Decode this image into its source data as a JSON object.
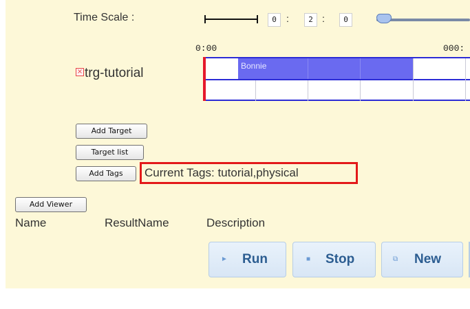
{
  "time_scale": {
    "label": "Time Scale :",
    "fields": [
      "0",
      "2",
      "0"
    ],
    "separator": ":"
  },
  "timeline": {
    "start_time": "0:00",
    "end_time": "000:",
    "bar_label": "Bonnie"
  },
  "target": {
    "icon": "close-icon",
    "name": "trg-tutorial"
  },
  "buttons": {
    "add_target": "Add Target",
    "target_list": "Target list",
    "add_tags": "Add Tags",
    "add_viewer": "Add Viewer"
  },
  "current_tags": "Current Tags: tutorial,physical",
  "columns": [
    "Name",
    "ResultName",
    "Description"
  ],
  "actions": {
    "run": "Run",
    "stop": "Stop",
    "new": "New"
  },
  "colors": {
    "panel": "#fdf8d8",
    "timeline_border": "#2b2bd6",
    "bar": "#6a6af0",
    "cursor": "#e5182b",
    "tags_highlight": "#e31919",
    "action_text": "#2c5d91"
  }
}
